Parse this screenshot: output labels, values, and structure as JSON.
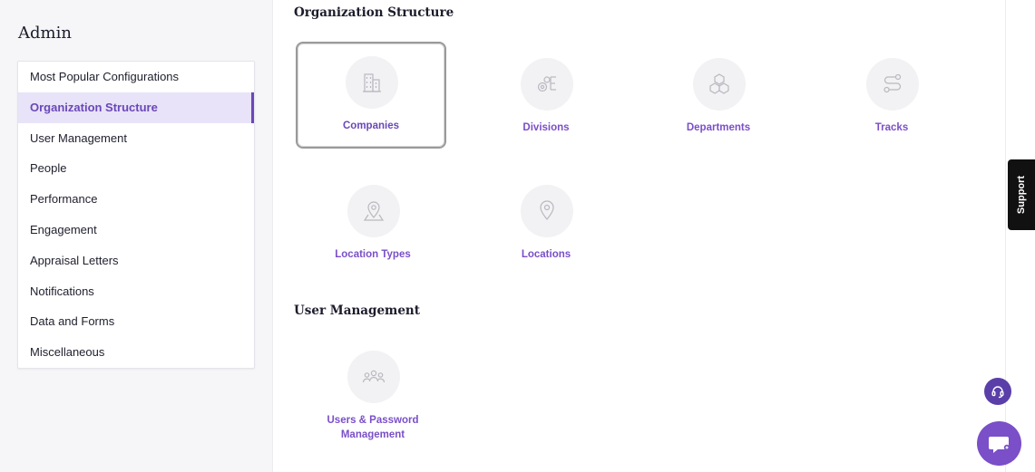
{
  "sidebar": {
    "title": "Admin",
    "items": [
      {
        "label": "Most Popular Configurations"
      },
      {
        "label": "Organization Structure",
        "active": true
      },
      {
        "label": "User Management"
      },
      {
        "label": "People"
      },
      {
        "label": "Performance"
      },
      {
        "label": "Engagement"
      },
      {
        "label": "Appraisal Letters"
      },
      {
        "label": "Notifications"
      },
      {
        "label": "Data and Forms"
      },
      {
        "label": "Miscellaneous"
      }
    ]
  },
  "main": {
    "org_section": {
      "title": "Organization Structure",
      "tiles": [
        {
          "label": "Companies",
          "icon": "building-icon",
          "selected": true
        },
        {
          "label": "Divisions",
          "icon": "gears-icon"
        },
        {
          "label": "Departments",
          "icon": "boxes-icon"
        },
        {
          "label": "Tracks",
          "icon": "route-icon"
        },
        {
          "label": "Location Types",
          "icon": "map-pin-icon"
        },
        {
          "label": "Locations",
          "icon": "location-pin-icon"
        }
      ]
    },
    "user_section": {
      "title": "User Management",
      "tiles": [
        {
          "label": "Users & Password Management",
          "icon": "users-group-icon"
        }
      ]
    }
  },
  "support": {
    "label": "Support"
  },
  "colors": {
    "accent": "#7a4fc8",
    "active_bg": "#e8e3f8",
    "support_bg": "#111111"
  }
}
